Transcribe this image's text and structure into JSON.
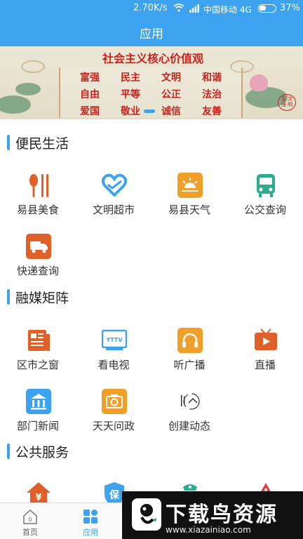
{
  "status": {
    "speed": "2.70K/s",
    "carrier": "中国移动 4G",
    "battery": "37%"
  },
  "header": {
    "title": "应用"
  },
  "banner": {
    "headline": "社会主义核心价值观",
    "values": [
      [
        "富强",
        "民主",
        "文明",
        "和谐"
      ],
      [
        "自由",
        "平等",
        "公正",
        "法治"
      ],
      [
        "爱国",
        "敬业",
        "诚信",
        "友善"
      ]
    ],
    "seal": "富 文 强 明"
  },
  "sections": [
    {
      "title": "便民生活",
      "items": [
        {
          "label": "易县美食",
          "icon": "food-icon",
          "color": "#e0602a"
        },
        {
          "label": "文明超市",
          "icon": "heart-icon",
          "color": "#3da2ef"
        },
        {
          "label": "易县天气",
          "icon": "weather-icon",
          "color": "#f0a028"
        },
        {
          "label": "公交查询",
          "icon": "bus-icon",
          "color": "#2eaa8e"
        },
        {
          "label": "快递查询",
          "icon": "delivery-icon",
          "color": "#e0602a"
        }
      ]
    },
    {
      "title": "融媒矩阵",
      "items": [
        {
          "label": "区市之窗",
          "icon": "news-icon",
          "color": "#e0602a"
        },
        {
          "label": "看电视",
          "icon": "tv-icon",
          "color": "#3da2ef",
          "badge": "YTTV"
        },
        {
          "label": "听广播",
          "icon": "headphones-icon",
          "color": "#f0a028"
        },
        {
          "label": "直播",
          "icon": "live-icon",
          "color": "#e0602a"
        },
        {
          "label": "部门新闻",
          "icon": "building-icon",
          "color": "#3da2ef"
        },
        {
          "label": "天天问政",
          "icon": "camera-icon",
          "color": "#f0a028"
        },
        {
          "label": "创建动态",
          "icon": "chinese-logo-icon",
          "color": "#333333"
        }
      ]
    },
    {
      "title": "公共服务",
      "items": [
        {
          "label": "",
          "icon": "house-fund-icon",
          "color": "#e0602a"
        },
        {
          "label": "",
          "icon": "insurance-icon",
          "color": "#3da2ef",
          "badge": "保"
        },
        {
          "label": "",
          "icon": "police-icon",
          "color": "#2eaa8e"
        },
        {
          "label": "",
          "icon": "warning-icon",
          "color": "#e04040"
        }
      ]
    }
  ],
  "nav": [
    {
      "label": "首页",
      "icon": "home-icon",
      "active": false
    },
    {
      "label": "应用",
      "icon": "apps-icon",
      "active": true
    }
  ],
  "watermark": {
    "title": "下载鸟资源",
    "url": "www.xiazainiao.com"
  },
  "accent": "#3da2ef"
}
